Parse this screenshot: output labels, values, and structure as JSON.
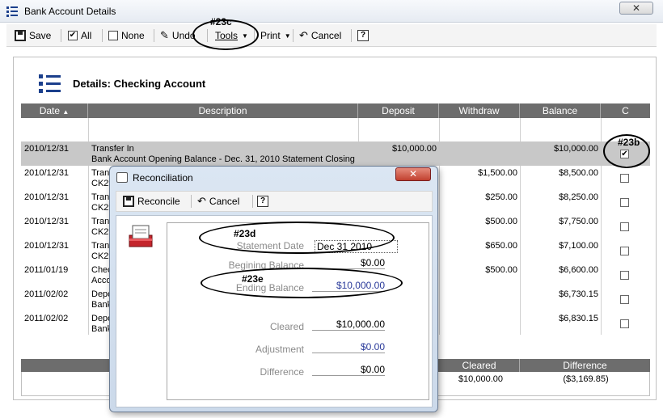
{
  "window": {
    "title": "Bank Account Details",
    "close_glyph": "✕"
  },
  "toolbar": {
    "save": "Save",
    "all": "All",
    "none": "None",
    "undo": "Undo",
    "tools": "Tools",
    "print": "Print",
    "cancel": "Cancel",
    "help": "?"
  },
  "details": {
    "title": "Details: Checking Account"
  },
  "grid": {
    "headers": [
      "Date",
      "Description",
      "Deposit",
      "Withdraw",
      "Balance",
      "C"
    ],
    "rows": [
      {
        "date": "2010/12/31",
        "desc1": "Transfer In",
        "desc2": "Bank Account Opening Balance - Dec. 31, 2010 Statement Closing B",
        "deposit": "$10,000.00",
        "withdraw": "",
        "balance": "$10,000.00",
        "checked": "✔"
      },
      {
        "date": "2010/12/31",
        "desc1": "Tran",
        "desc2": "CK29",
        "deposit": "",
        "withdraw": "$1,500.00",
        "balance": "$8,500.00",
        "checked": ""
      },
      {
        "date": "2010/12/31",
        "desc1": "Tran",
        "desc2": "CK29",
        "deposit": "",
        "withdraw": "$250.00",
        "balance": "$8,250.00",
        "checked": ""
      },
      {
        "date": "2010/12/31",
        "desc1": "Tran",
        "desc2": "CK29",
        "deposit": "",
        "withdraw": "$500.00",
        "balance": "$7,750.00",
        "checked": ""
      },
      {
        "date": "2010/12/31",
        "desc1": "Tran",
        "desc2": "CK29",
        "deposit": "",
        "withdraw": "$650.00",
        "balance": "$7,100.00",
        "checked": ""
      },
      {
        "date": "2011/01/19",
        "desc1": "Chec",
        "desc2": "Acco",
        "deposit": "",
        "withdraw": "$500.00",
        "balance": "$6,600.00",
        "checked": ""
      },
      {
        "date": "2011/02/02",
        "desc1": "Depo",
        "desc2": "Bank",
        "deposit": "",
        "withdraw": "",
        "balance": "$6,730.15",
        "checked": ""
      },
      {
        "date": "2011/02/02",
        "desc1": "Depo",
        "desc2": "Bank",
        "deposit": "",
        "withdraw": "",
        "balance": "$6,830.15",
        "checked": ""
      }
    ]
  },
  "summary": {
    "cleared_label": "Cleared",
    "difference_label": "Difference",
    "cleared_value": "$10,000.00",
    "difference_value": "($3,169.85)"
  },
  "annotations": {
    "a23c": "#23c",
    "a23b": "#23b",
    "a23d": "#23d",
    "a23e": "#23e"
  },
  "dialog": {
    "title": "Reconciliation",
    "close_glyph": "✕",
    "reconcile": "Reconcile",
    "cancel": "Cancel",
    "help": "?",
    "fields": {
      "statement_date_label": "Statement Date",
      "statement_date_value": "Dec 31 2010",
      "beginning_balance_label": "Begining Balance",
      "beginning_balance_value": "$0.00",
      "ending_balance_label": "Ending Balance",
      "ending_balance_value": "$10,000.00",
      "cleared_label": "Cleared",
      "cleared_value": "$10,000.00",
      "adjustment_label": "Adjustment",
      "adjustment_value": "$0.00",
      "difference_label": "Difference",
      "difference_value": "$0.00"
    }
  }
}
